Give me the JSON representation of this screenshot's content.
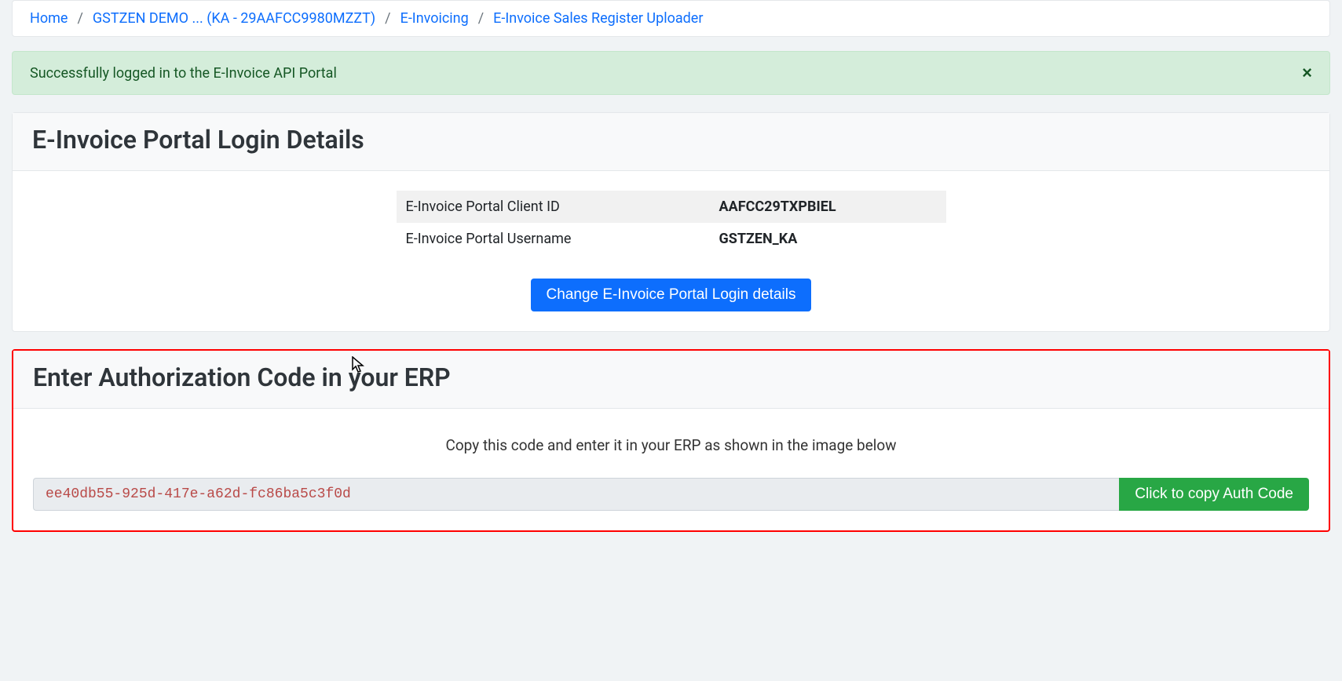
{
  "breadcrumb": {
    "home": "Home",
    "company": "GSTZEN DEMO ... (KA - 29AAFCC9980MZZT)",
    "einvoicing": "E-Invoicing",
    "uploader": "E-Invoice Sales Register Uploader",
    "sep": "/"
  },
  "alert": {
    "message": "Successfully logged in to the E-Invoice API Portal",
    "close": "×"
  },
  "login_card": {
    "title": "E-Invoice Portal Login Details",
    "rows": [
      {
        "label": "E-Invoice Portal Client ID",
        "value": "AAFCC29TXPBIEL"
      },
      {
        "label": "E-Invoice Portal Username",
        "value": "GSTZEN_KA"
      }
    ],
    "button": "Change E-Invoice Portal Login details"
  },
  "auth_card": {
    "title": "Enter Authorization Code in your ERP",
    "instruction": "Copy this code and enter it in your ERP as shown in the image below",
    "code": "ee40db55-925d-417e-a62d-fc86ba5c3f0d",
    "copy_button": "Click to copy Auth Code"
  }
}
